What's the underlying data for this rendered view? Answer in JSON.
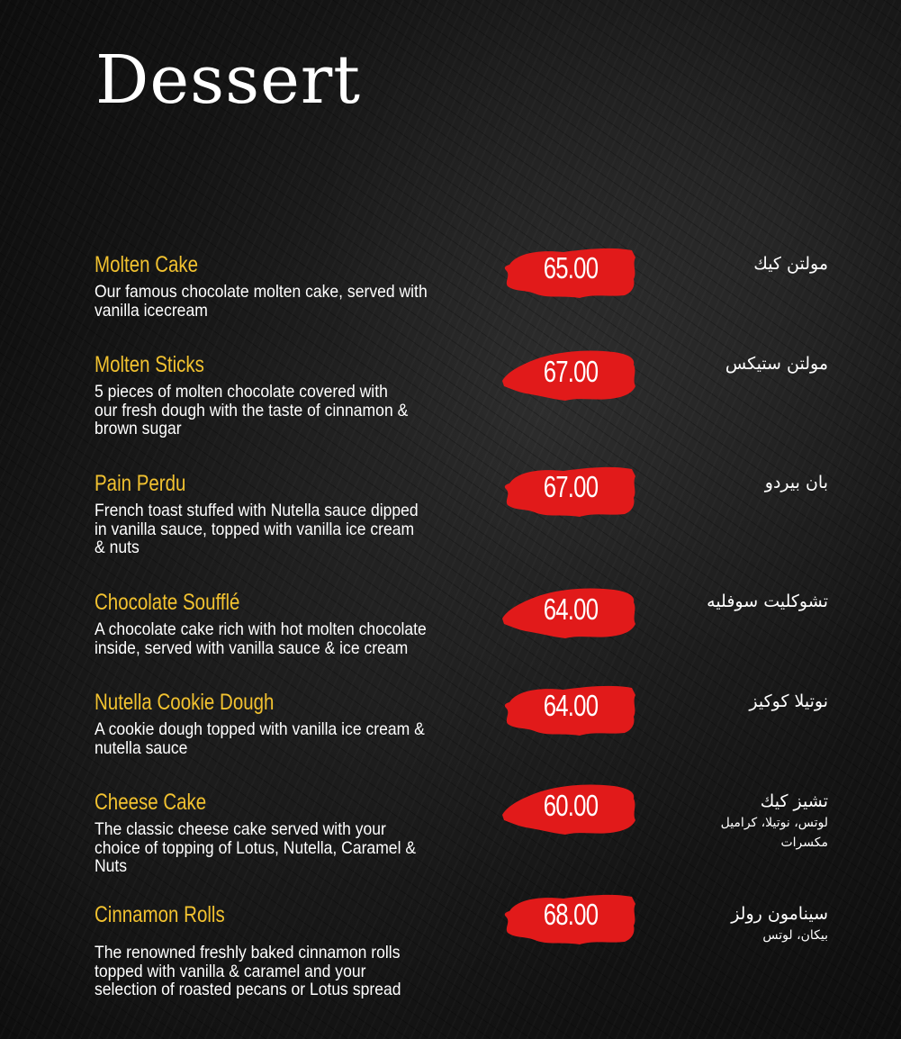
{
  "page": {
    "title": "Dessert",
    "accent_color": "#f2c230",
    "price_badge_color": "#e11a1a"
  },
  "items": [
    {
      "name": "Molten Cake",
      "description_lines": [
        "Our famous chocolate molten cake, served with",
        "vanilla icecream"
      ],
      "price": "65.00",
      "name_ar": "مولتن كيك",
      "sub_ar": []
    },
    {
      "name": "Molten Sticks",
      "description_lines": [
        "5 pieces of molten chocolate covered with",
        "our fresh dough with the taste of cinnamon &",
        "brown sugar"
      ],
      "price": "67.00",
      "name_ar": "مولتن ستيكس",
      "sub_ar": []
    },
    {
      "name": "Pain Perdu",
      "description_lines": [
        "French toast stuffed with Nutella sauce dipped",
        "in vanilla sauce, topped with vanilla ice cream",
        "& nuts"
      ],
      "price": "67.00",
      "name_ar": "بان بيردو",
      "sub_ar": []
    },
    {
      "name": "Chocolate Soufflé",
      "description_lines": [
        "A chocolate cake rich with hot molten chocolate",
        "inside, served with vanilla sauce & ice cream"
      ],
      "price": "64.00",
      "name_ar": "تشوكليت سوفليه",
      "sub_ar": []
    },
    {
      "name": "Nutella Cookie Dough",
      "description_lines": [
        "A cookie dough topped with vanilla ice cream &",
        "nutella sauce"
      ],
      "price": "64.00",
      "name_ar": "نوتيلا كوكيز",
      "sub_ar": []
    },
    {
      "name": "Cheese Cake",
      "description_lines": [
        "The classic cheese cake served with your",
        "choice of topping of Lotus, Nutella, Caramel &",
        "Nuts"
      ],
      "price": "60.00",
      "name_ar": "تشيز كيك",
      "sub_ar": [
        "لوتس، نوتيلا، كراميل",
        "مكسرات"
      ]
    },
    {
      "name": "Cinnamon Rolls",
      "description_lines": [
        "The renowned freshly baked cinnamon rolls",
        "topped with vanilla & caramel and your",
        "selection of roasted pecans or Lotus spread"
      ],
      "price": "68.00",
      "name_ar": "سينامون رولز",
      "sub_ar": [
        "بيكان، لوتس"
      ]
    }
  ]
}
